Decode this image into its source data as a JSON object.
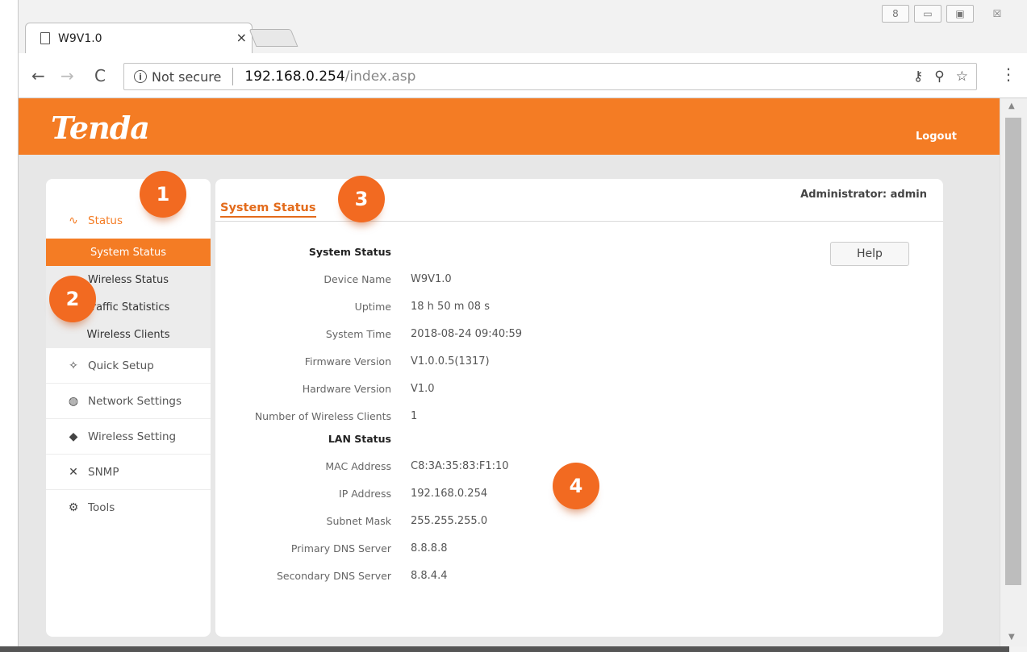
{
  "browser": {
    "tab_title": "W9V1.0",
    "tab_close": "×",
    "not_secure": "Not secure",
    "url_host": "192.168.0.254",
    "url_path": "/index.asp",
    "win_controls": [
      "8",
      "▭",
      "▣",
      "☒"
    ]
  },
  "header": {
    "logo": "Tenda",
    "logout": "Logout",
    "brand_color": "#f47c24"
  },
  "sidebar": {
    "status_label": "Status",
    "sub_items": [
      "System Status",
      "Wireless Status",
      "Traffic Statistics",
      "Wireless Clients"
    ],
    "active_sub": "System Status",
    "items": [
      {
        "label": "Quick Setup",
        "icon": "quick-setup-icon"
      },
      {
        "label": "Network Settings",
        "icon": "globe-icon"
      },
      {
        "label": "Wireless Setting",
        "icon": "wifi-icon"
      },
      {
        "label": "SNMP",
        "icon": "tools-cross-icon"
      },
      {
        "label": "Tools",
        "icon": "gears-icon"
      }
    ]
  },
  "content": {
    "tab": "System Status",
    "admin": "Administrator: admin",
    "help": "Help",
    "sections": [
      {
        "heading": "System Status",
        "rows": [
          [
            "Device Name",
            "W9V1.0"
          ],
          [
            "Uptime",
            "18 h 50 m 08 s"
          ],
          [
            "System Time",
            "2018-08-24 09:40:59"
          ],
          [
            "Firmware Version",
            "V1.0.0.5(1317)"
          ],
          [
            "Hardware Version",
            "V1.0"
          ],
          [
            "Number of Wireless Clients",
            "1"
          ]
        ]
      },
      {
        "heading": "LAN Status",
        "rows": [
          [
            "MAC Address",
            "C8:3A:35:83:F1:10"
          ],
          [
            "IP Address",
            "192.168.0.254"
          ],
          [
            "Subnet Mask",
            "255.255.255.0"
          ],
          [
            "Primary DNS Server",
            "8.8.8.8"
          ],
          [
            "Secondary DNS Server",
            "8.8.4.4"
          ]
        ]
      }
    ]
  },
  "badges": [
    "1",
    "2",
    "3",
    "4"
  ]
}
